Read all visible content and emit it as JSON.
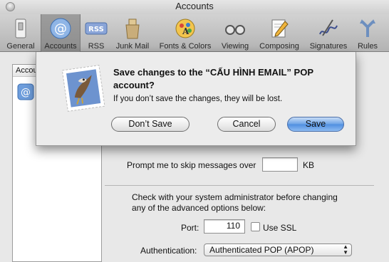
{
  "window": {
    "title": "Accounts"
  },
  "toolbar": {
    "items": [
      {
        "label": "General",
        "icon": "switch-icon"
      },
      {
        "label": "Accounts",
        "icon": "at-sign-icon",
        "active": true
      },
      {
        "label": "RSS",
        "icon": "rss-icon"
      },
      {
        "label": "Junk Mail",
        "icon": "trash-bag-icon"
      },
      {
        "label": "Fonts & Colors",
        "icon": "font-palette-icon"
      },
      {
        "label": "Viewing",
        "icon": "glasses-icon"
      },
      {
        "label": "Composing",
        "icon": "pencil-paper-icon"
      },
      {
        "label": "Signatures",
        "icon": "signature-icon"
      },
      {
        "label": "Rules",
        "icon": "rules-icon"
      }
    ]
  },
  "accounts": {
    "header": "Accounts"
  },
  "settings": {
    "skip_label": "Prompt me to skip messages over",
    "skip_value": "",
    "skip_unit": "KB",
    "admin_note": "Check with your system administrator before changing any of the advanced options below:",
    "port_label": "Port:",
    "port_value": "110",
    "ssl_label": "Use SSL",
    "auth_label": "Authentication:",
    "auth_value": "Authenticated POP (APOP)"
  },
  "dialog": {
    "message": "Save changes to the “CẤU HÌNH EMAIL” POP account?",
    "info": "If you don’t save the changes, they will be lost.",
    "dont_save": "Don’t Save",
    "cancel": "Cancel",
    "save": "Save"
  },
  "colors": {
    "accent": "#4f8ee0",
    "toolbar": "#c0c0c0"
  }
}
